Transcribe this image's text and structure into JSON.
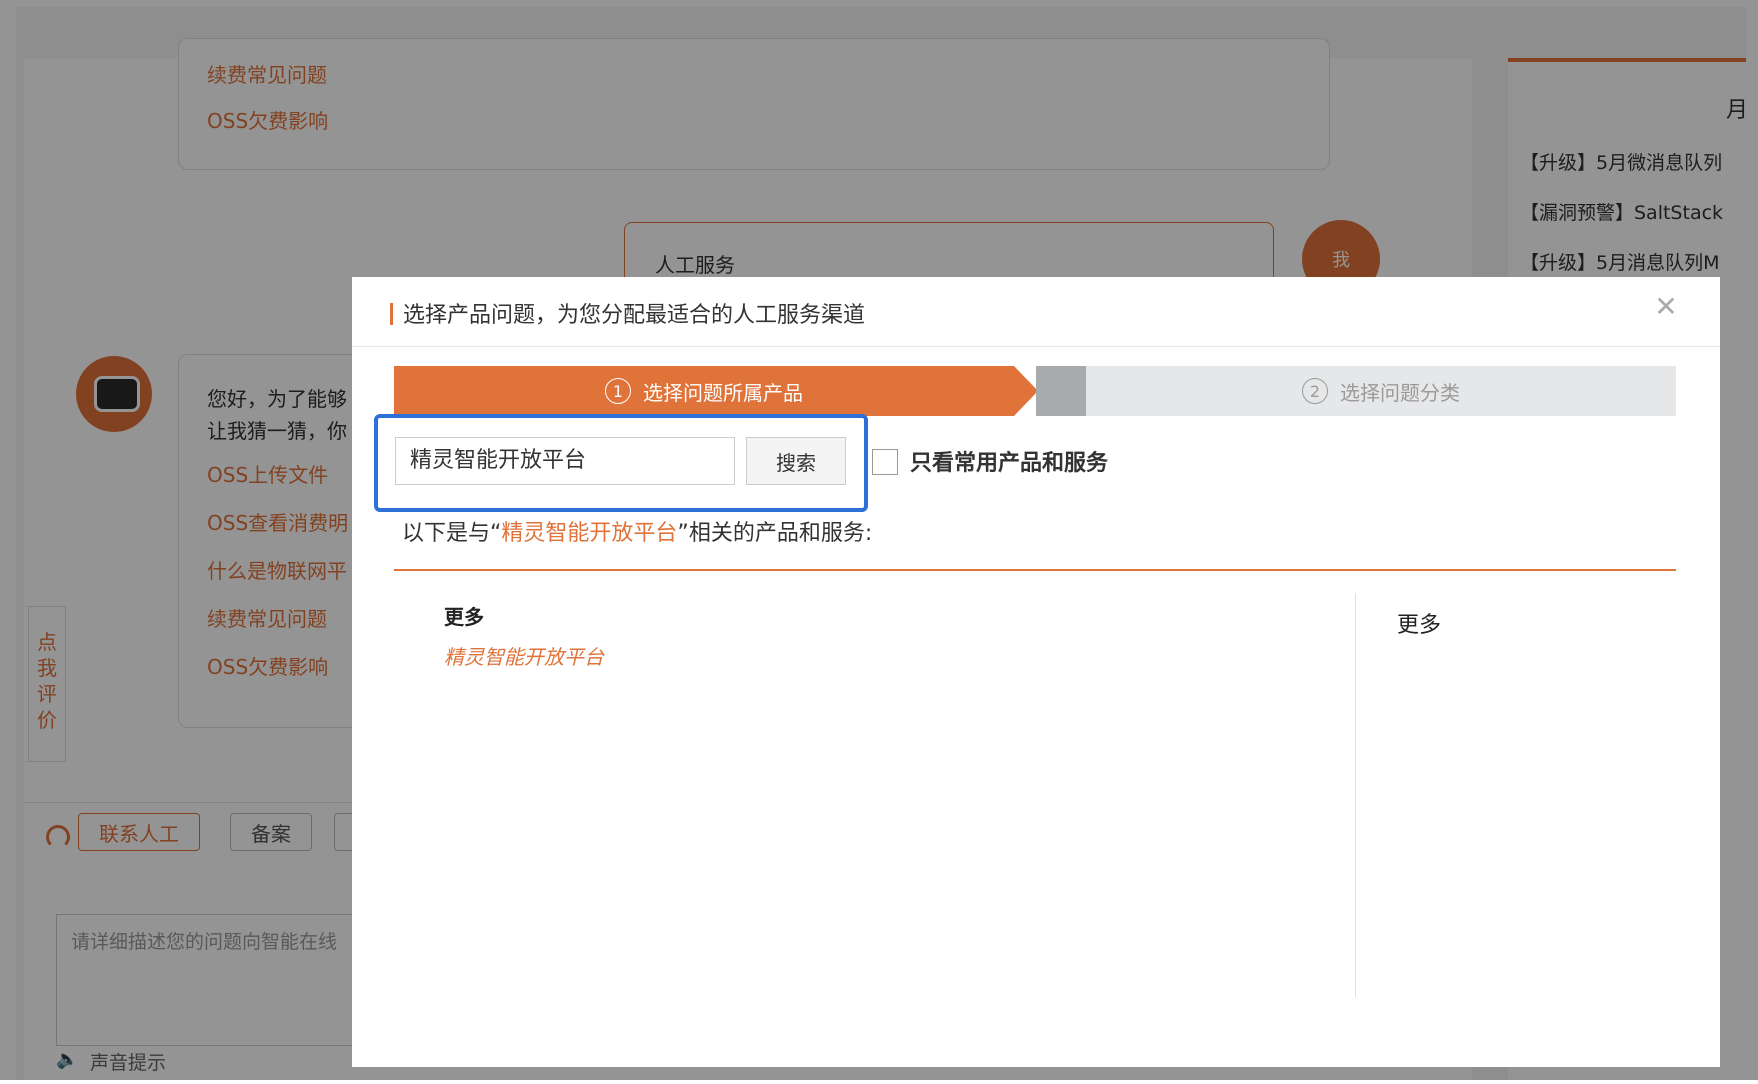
{
  "background": {
    "top_links": [
      "续费常见问题",
      "OSS欠费影响"
    ],
    "user_message": "人工服务",
    "user_avatar_label": "我",
    "bot_lines": [
      "您好，为了能够",
      "让我猜一猜，你"
    ],
    "bot_links": [
      "OSS上传文件",
      "OSS查看消费明",
      "什么是物联网平",
      "续费常见问题",
      "OSS欠费影响"
    ],
    "rate_tab": [
      "点",
      "我",
      "评",
      "价"
    ],
    "contact_button": "联系人工",
    "filing_button": "备案",
    "input_placeholder": "请详细描述您的问题向智能在线",
    "sound_tip": "声音提示",
    "right_panel": {
      "heading_fragment": "月",
      "news": [
        "【升级】5月微消息队列",
        "【漏洞预警】SaltStack",
        "【升级】5月消息队列M"
      ]
    }
  },
  "modal": {
    "title": "选择产品问题，为您分配最适合的人工服务渠道",
    "steps": [
      {
        "num": "1",
        "label": "选择问题所属产品",
        "active": true
      },
      {
        "num": "2",
        "label": "选择问题分类",
        "active": false
      }
    ],
    "search": {
      "value": "精灵智能开放平台",
      "button": "搜索"
    },
    "checkbox_label": "只看常用产品和服务",
    "result_prefix": "以下是与“",
    "result_keyword": "精灵智能开放平台",
    "result_suffix": "”相关的产品和服务:",
    "left_column": {
      "title": "更多",
      "item": "精灵智能开放平台"
    },
    "right_column": {
      "title": "更多"
    }
  },
  "colors": {
    "accent": "#e07339",
    "highlight": "#2e6fd8"
  }
}
